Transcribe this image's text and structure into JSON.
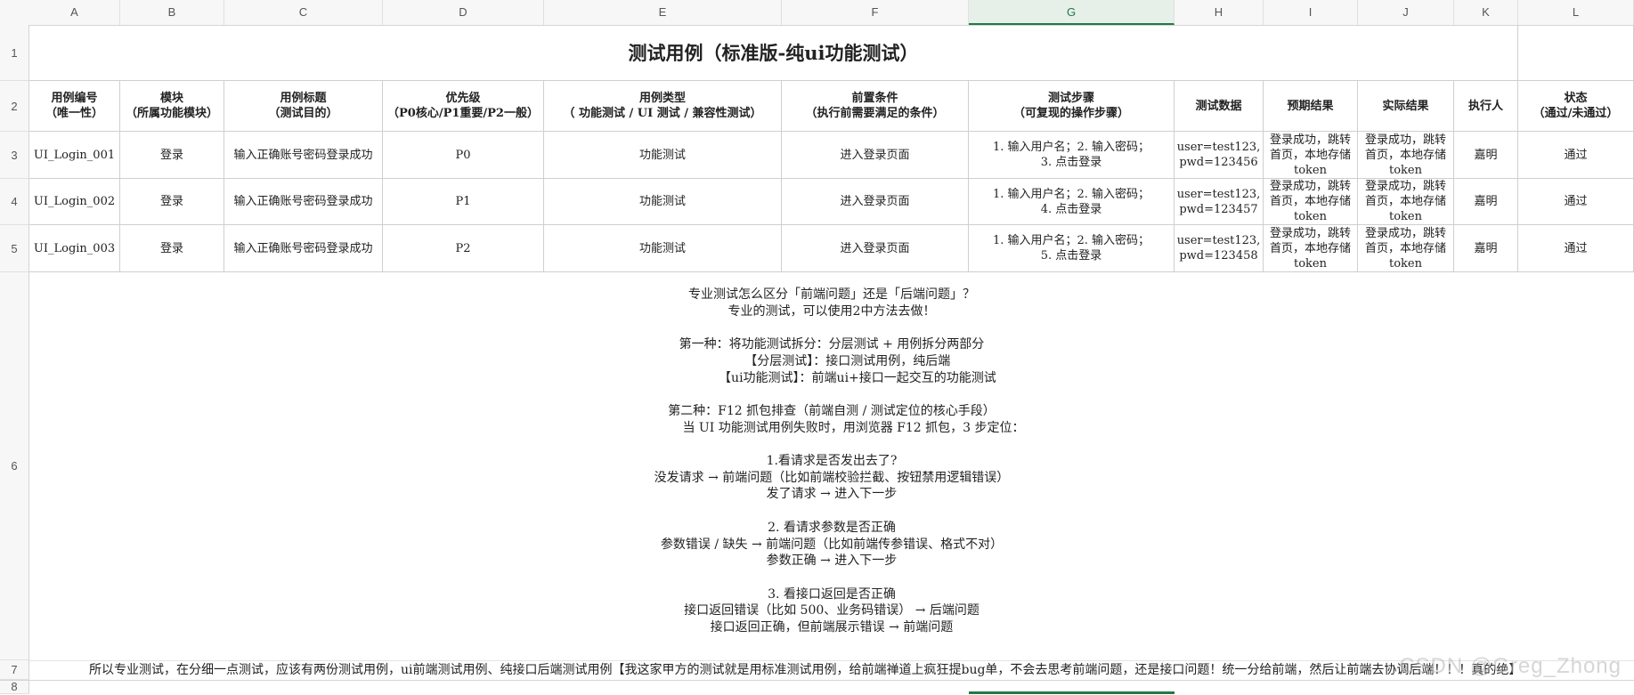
{
  "columns": [
    "A",
    "B",
    "C",
    "D",
    "E",
    "F",
    "G",
    "H",
    "I",
    "J",
    "K",
    "L"
  ],
  "selected_column": "G",
  "rows": [
    "1",
    "2",
    "3",
    "4",
    "5",
    "6",
    "7",
    "8"
  ],
  "title": "测试用例（标准版-纯ui功能测试）",
  "headers": [
    [
      "用例编号",
      "（唯一性）"
    ],
    [
      "模块",
      "（所属功能模块）"
    ],
    [
      "用例标题",
      "（测试目的）"
    ],
    [
      "优先级",
      "（P0核心/P1重要/P2一般）"
    ],
    [
      "用例类型",
      "（ 功能测试 / UI 测试 / 兼容性测试）"
    ],
    [
      "前置条件",
      "（执行前需要满足的条件）"
    ],
    [
      "测试步骤",
      "（可复现的操作步骤）"
    ],
    [
      "测试数据"
    ],
    [
      "预期结果"
    ],
    [
      "实际结果"
    ],
    [
      "执行人"
    ],
    [
      "状态",
      "（通过/未通过）"
    ]
  ],
  "test_cases": [
    {
      "id": "UI_Login_001",
      "module": "登录",
      "title": "输入正确账号密码登录成功",
      "priority": "P0",
      "type": "功能测试",
      "precondition": "进入登录页面",
      "steps": [
        "1. 输入用户名；2. 输入密码；",
        "3. 点击登录"
      ],
      "data": [
        "user=test123,",
        "pwd=123456"
      ],
      "expected": [
        "登录成功，跳转",
        "首页，本地存储",
        "token"
      ],
      "actual": [
        "登录成功，跳转",
        "首页，本地存储",
        "token"
      ],
      "executor": "嘉明",
      "status": "通过"
    },
    {
      "id": "UI_Login_002",
      "module": "登录",
      "title": "输入正确账号密码登录成功",
      "priority": "P1",
      "type": "功能测试",
      "precondition": "进入登录页面",
      "steps": [
        "1. 输入用户名；2. 输入密码；",
        "4. 点击登录"
      ],
      "data": [
        "user=test123,",
        "pwd=123457"
      ],
      "expected": [
        "登录成功，跳转",
        "首页，本地存储",
        "token"
      ],
      "actual": [
        "登录成功，跳转",
        "首页，本地存储",
        "token"
      ],
      "executor": "嘉明",
      "status": "通过"
    },
    {
      "id": "UI_Login_003",
      "module": "登录",
      "title": "输入正确账号密码登录成功",
      "priority": "P2",
      "type": "功能测试",
      "precondition": "进入登录页面",
      "steps": [
        "1. 输入用户名；2. 输入密码；",
        "5. 点击登录"
      ],
      "data": [
        "user=test123,",
        "pwd=123458"
      ],
      "expected": [
        "登录成功，跳转",
        "首页，本地存储",
        "token"
      ],
      "actual": [
        "登录成功，跳转",
        "首页，本地存储",
        "token"
      ],
      "executor": "嘉明",
      "status": "通过"
    }
  ],
  "notes": [
    "专业测试怎么区分「前端问题」还是「后端问题」？",
    "专业的测试，可以使用2中方法去做！",
    "",
    "第一种：将功能测试拆分：分层测试 + 用例拆分两部分",
    "        【分层测试】：接口测试用例，纯后端",
    "             【ui功能测试】：前端ui+接口一起交互的功能测试",
    "",
    "第二种：F12 抓包排查（前端自测 / 测试定位的核心手段）",
    "           当 UI 功能测试用例失败时，用浏览器 F12 抓包，3 步定位：",
    "",
    "1.看请求是否发出去了?",
    "没发请求 → 前端问题（比如前端校验拦截、按钮禁用逻辑错误）",
    "发了请求 → 进入下一步",
    "",
    "2. 看请求参数是否正确",
    "参数错误 / 缺失 → 前端问题（比如前端传参错误、格式不对）",
    "参数正确 → 进入下一步",
    "",
    "3. 看接口返回是否正确",
    "接口返回错误（比如 500、业务码错误） → 后端问题",
    "接口返回正确，但前端展示错误 → 前端问题"
  ],
  "footer_text": "所以专业测试，在分细一点测试，应该有两份测试用例，ui前端测试用例、纯接口后端测试用例【我这家甲方的测试就是用标准测试用例，给前端禅道上疯狂提bug单，不会去思考前端问题，还是接口问题！统一分给前端，然后让前端去协调后端！！！真的绝】",
  "watermark": "CSDN @Greg_Zhong"
}
